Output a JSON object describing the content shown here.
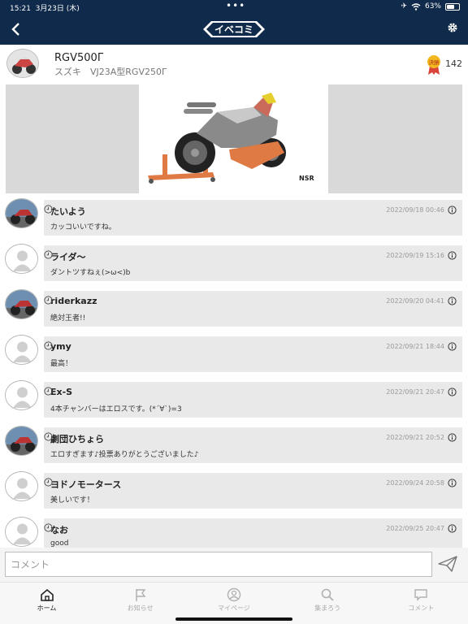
{
  "status": {
    "time": "15:21",
    "date": "3月23日 (木)",
    "battery": "63%",
    "battery_level": 0.63
  },
  "nav": {
    "logo_text": "イベコミ"
  },
  "event": {
    "title": "RGV500Γ",
    "subtitle": "スズキ　VJ23A型RGV250Γ",
    "badge_text": "決勝",
    "vote_count": "142"
  },
  "photo": {
    "plate_text": "NSR"
  },
  "comments": [
    {
      "name": "たいよう",
      "text": "カッコいいですね。",
      "date": "2022/09/18 00:46",
      "avatar": "photo"
    },
    {
      "name": "ライダ〜",
      "text": "ダントツすねぇ(>ω<)b",
      "date": "2022/09/19 15:16",
      "avatar": "default"
    },
    {
      "name": "riderkazz",
      "text": "絶対王者!!",
      "date": "2022/09/20 04:41",
      "avatar": "photo"
    },
    {
      "name": "ymy",
      "text": "最高！",
      "date": "2022/09/21 18:44",
      "avatar": "default"
    },
    {
      "name": "Ex-S",
      "text": "4本チャンバーはエロスです。(*´∀`)=3",
      "date": "2022/09/21 20:47",
      "avatar": "default"
    },
    {
      "name": "劇団ひちょら",
      "text": "エロすぎます♪投票ありがとうございました♪",
      "date": "2022/09/21 20:52",
      "avatar": "photo"
    },
    {
      "name": "ヨドノモータース",
      "text": "美しいです！",
      "date": "2022/09/24 20:58",
      "avatar": "default"
    },
    {
      "name": "なお",
      "text": "good",
      "date": "2022/09/25 20:47",
      "avatar": "default"
    }
  ],
  "input": {
    "placeholder": "コメント",
    "value": ""
  },
  "tabs": [
    {
      "label": "ホーム",
      "icon": "home-icon",
      "active": true
    },
    {
      "label": "お知らせ",
      "icon": "flag-icon",
      "active": false
    },
    {
      "label": "マイページ",
      "icon": "person-icon",
      "active": false
    },
    {
      "label": "集まろう",
      "icon": "search-icon",
      "active": false
    },
    {
      "label": "コメント",
      "icon": "comment-icon",
      "active": false
    }
  ],
  "colors": {
    "nav": "#0f2a4a",
    "bubble": "#e9e9e9",
    "stand": "#e07a45"
  }
}
